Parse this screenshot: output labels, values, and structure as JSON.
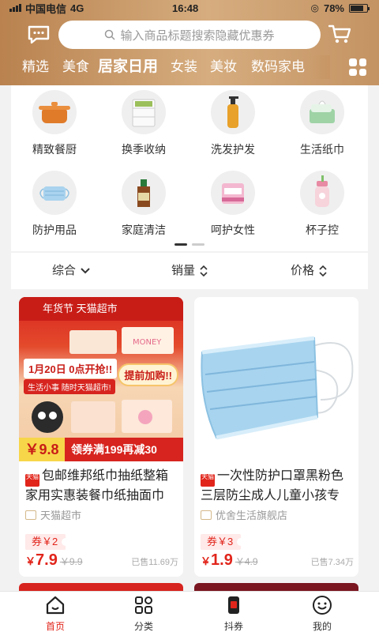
{
  "status": {
    "carrier": "中国电信",
    "network": "4G",
    "time": "16:48",
    "battery": "78%",
    "battery_level": 0.78
  },
  "search": {
    "placeholder": "输入商品标题搜索隐藏优惠券"
  },
  "tabs": [
    {
      "label": "精选"
    },
    {
      "label": "美食"
    },
    {
      "label": "居家日用",
      "active": true
    },
    {
      "label": "女装"
    },
    {
      "label": "美妆"
    },
    {
      "label": "数码家电"
    }
  ],
  "categories": [
    {
      "label": "精致餐厨",
      "icon": "pot-icon"
    },
    {
      "label": "换季收纳",
      "icon": "storage-box-icon"
    },
    {
      "label": "洗发护发",
      "icon": "shampoo-bottle-icon"
    },
    {
      "label": "生活纸巾",
      "icon": "tissue-pack-icon"
    },
    {
      "label": "防护用品",
      "icon": "face-mask-icon"
    },
    {
      "label": "家庭清洁",
      "icon": "disinfectant-bottle-icon"
    },
    {
      "label": "呵护女性",
      "icon": "sanitary-pad-icon"
    },
    {
      "label": "杯子控",
      "icon": "cup-icon"
    }
  ],
  "sort": {
    "general": "综合",
    "sales": "销量",
    "price": "价格"
  },
  "products": [
    {
      "title": "包邮维邦纸巾抽纸整箱家用实惠装餐巾纸抽面巾纸...",
      "badge": "天猫",
      "shop": "天猫超市",
      "coupon": "券￥2",
      "currency": "￥",
      "price": "7.9",
      "old_price": "￥9.9",
      "sold": "已售11.69万",
      "promo": {
        "top": "年货节 天猫超市",
        "date": "1月20日 0点开抢!!",
        "sub": "生活小事 随时天猫超市!",
        "rush": "提前加购!!",
        "price": "￥9.8",
        "coupon": "领券满199再减30"
      }
    },
    {
      "title": "一次性防护口罩黑粉色三层防尘成人儿童小孩专用...",
      "badge": "天猫",
      "shop": "优舍生活旗舰店",
      "coupon": "券￥3",
      "currency": "￥",
      "price": "1.9",
      "old_price": "￥4.9",
      "sold": "已售7.34万"
    }
  ],
  "nav": [
    {
      "label": "首页",
      "icon": "home-icon",
      "active": true
    },
    {
      "label": "分类",
      "icon": "category-icon"
    },
    {
      "label": "抖券",
      "icon": "coupon-phone-icon"
    },
    {
      "label": "我的",
      "icon": "smile-profile-icon"
    }
  ],
  "colors": {
    "accent": "#e1251b",
    "header_gold": "#c49363"
  }
}
